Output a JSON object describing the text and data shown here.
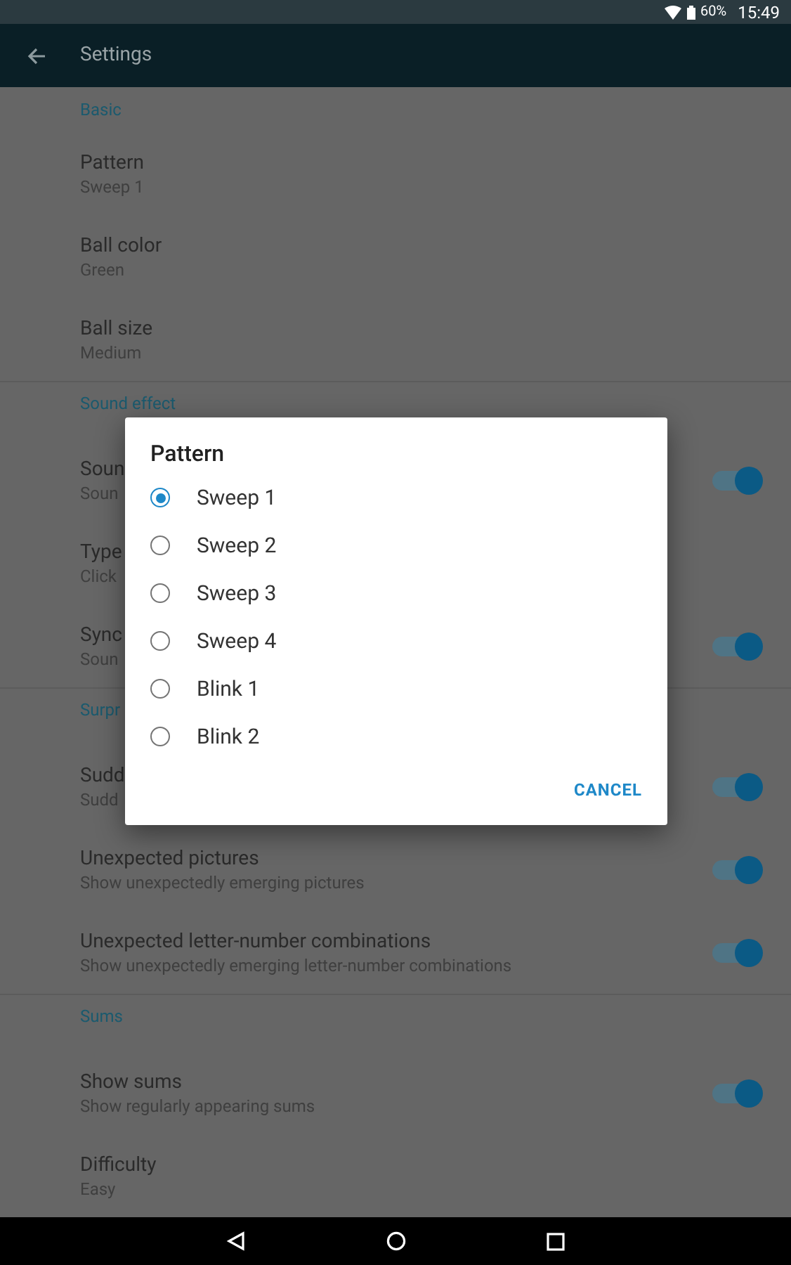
{
  "status_bar": {
    "battery": "60%",
    "time": "15:49"
  },
  "app_bar": {
    "title": "Settings"
  },
  "sections": [
    {
      "header": "Basic",
      "items": [
        {
          "kind": "plain",
          "title": "Pattern",
          "subtitle": "Sweep 1"
        },
        {
          "kind": "plain",
          "title": "Ball color",
          "subtitle": "Green"
        },
        {
          "kind": "plain",
          "title": "Ball size",
          "subtitle": "Medium"
        }
      ]
    },
    {
      "header": "Sound effect",
      "items": [
        {
          "kind": "switch",
          "title": "Soun",
          "subtitle": "Soun",
          "on": true
        },
        {
          "kind": "plain",
          "title": "Type",
          "subtitle": "Click"
        },
        {
          "kind": "switch",
          "title": "Sync",
          "subtitle": "Soun",
          "on": true
        }
      ]
    },
    {
      "header": "Surpr",
      "items": [
        {
          "kind": "switch",
          "title": "Sudd",
          "subtitle": "Sudd",
          "on": true
        },
        {
          "kind": "switch",
          "title": "Unexpected pictures",
          "subtitle": "Show unexpectedly emerging pictures",
          "on": true
        },
        {
          "kind": "switch",
          "title": "Unexpected letter-number combinations",
          "subtitle": "Show unexpectedly emerging letter-number combinations",
          "on": true
        }
      ]
    },
    {
      "header": "Sums",
      "items": [
        {
          "kind": "switch",
          "title": "Show sums",
          "subtitle": "Show regularly appearing sums",
          "on": true
        },
        {
          "kind": "plain",
          "title": "Difficulty",
          "subtitle": "Easy"
        }
      ]
    }
  ],
  "dialog": {
    "title": "Pattern",
    "options": [
      {
        "label": "Sweep 1",
        "selected": true
      },
      {
        "label": "Sweep 2",
        "selected": false
      },
      {
        "label": "Sweep 3",
        "selected": false
      },
      {
        "label": "Sweep 4",
        "selected": false
      },
      {
        "label": "Blink 1",
        "selected": false
      },
      {
        "label": "Blink 2",
        "selected": false
      }
    ],
    "button": "CANCEL"
  }
}
